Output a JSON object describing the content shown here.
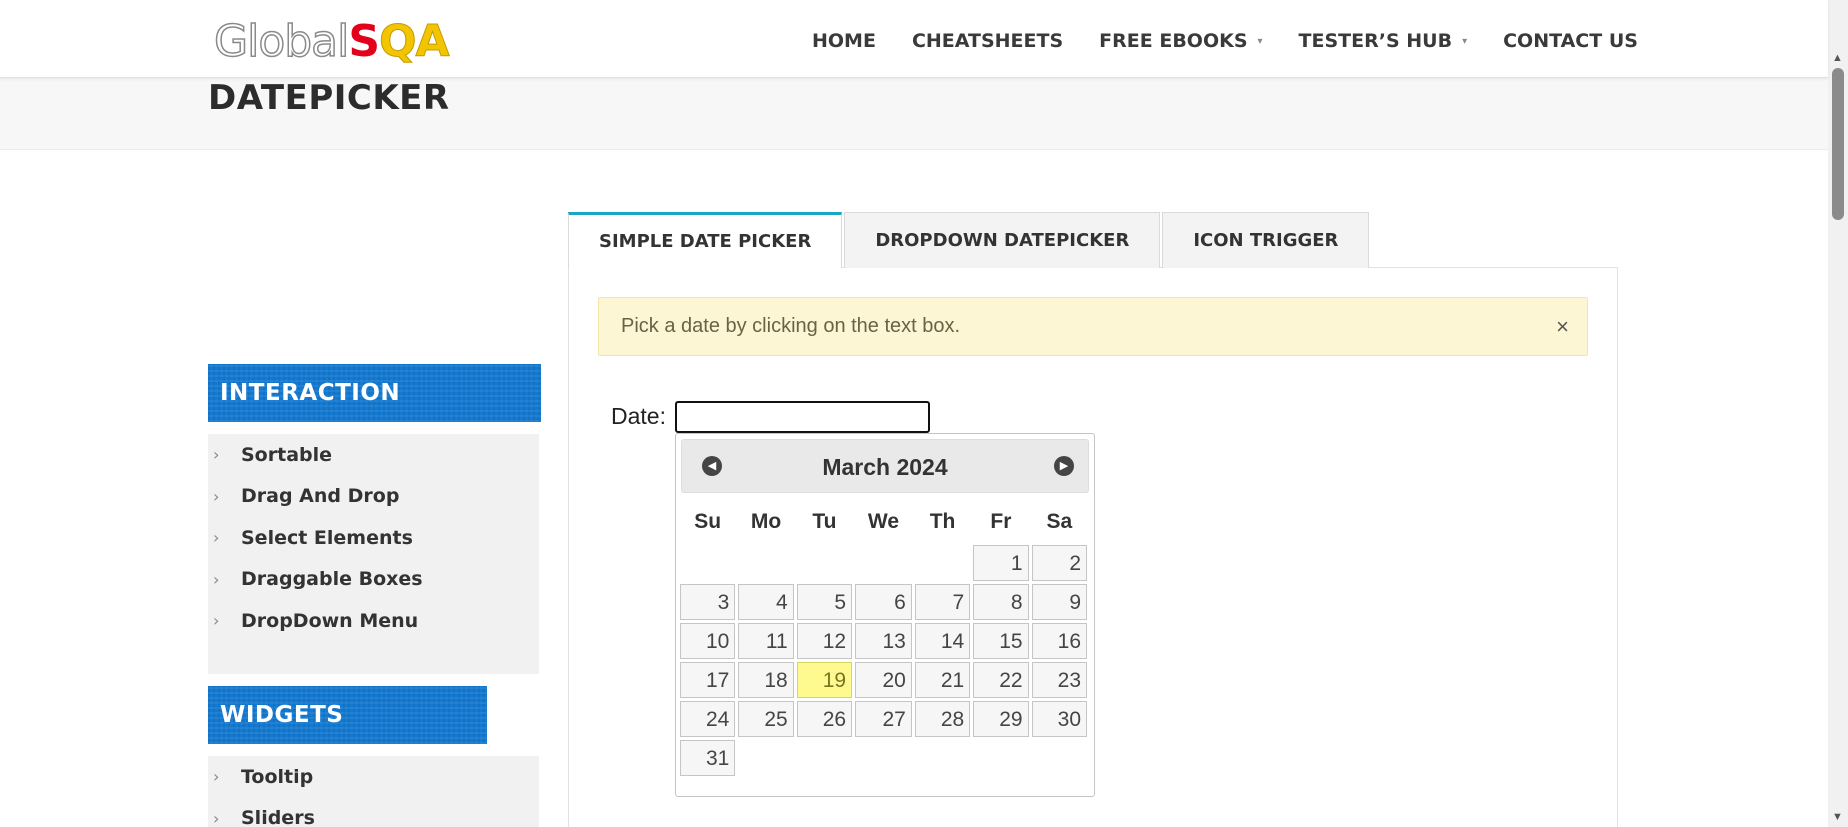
{
  "logo": {
    "part1": "Global",
    "part2": "S",
    "part3": "QA"
  },
  "nav": {
    "home": "HOME",
    "cheatsheets": "CHEATSHEETS",
    "free_ebooks": "FREE EBOOKS",
    "testers_hub": "TESTER’S HUB",
    "contact": "CONTACT US",
    "caret": "▾"
  },
  "page_title": "DATEPICKER",
  "sidebar": {
    "interaction_title": "INTERACTION",
    "interaction_items": [
      "Sortable",
      "Drag And Drop",
      "Select Elements",
      "Draggable Boxes",
      "DropDown Menu"
    ],
    "widgets_title": "WIDGETS",
    "widgets_items": [
      "Tooltip",
      "Sliders"
    ],
    "chevron": "›"
  },
  "tabs": [
    "SIMPLE DATE PICKER",
    "DROPDOWN DATEPICKER",
    "ICON TRIGGER"
  ],
  "alert": {
    "text": "Pick a date by clicking on the text box.",
    "close": "×"
  },
  "date_field": {
    "label": "Date:",
    "value": ""
  },
  "datepicker": {
    "month_year": "March 2024",
    "prev_icon": "◀",
    "next_icon": "▶",
    "weekdays": [
      "Su",
      "Mo",
      "Tu",
      "We",
      "Th",
      "Fr",
      "Sa"
    ],
    "weeks": [
      [
        "",
        "",
        "",
        "",
        "",
        "1",
        "2"
      ],
      [
        "3",
        "4",
        "5",
        "6",
        "7",
        "8",
        "9"
      ],
      [
        "10",
        "11",
        "12",
        "13",
        "14",
        "15",
        "16"
      ],
      [
        "17",
        "18",
        "19",
        "20",
        "21",
        "22",
        "23"
      ],
      [
        "24",
        "25",
        "26",
        "27",
        "28",
        "29",
        "30"
      ],
      [
        "31",
        "",
        "",
        "",
        "",
        "",
        ""
      ]
    ],
    "highlighted_day": "19"
  },
  "scrollbar": {
    "up": "▲",
    "down": "▼"
  },
  "colors": {
    "sidebar_header": "#1379d1",
    "tab_accent": "#18a6c8",
    "alert_bg": "#fcf6d5",
    "today_bg": "#fffa90",
    "logo_s": "#e3001b",
    "logo_qa": "#f2c500"
  }
}
